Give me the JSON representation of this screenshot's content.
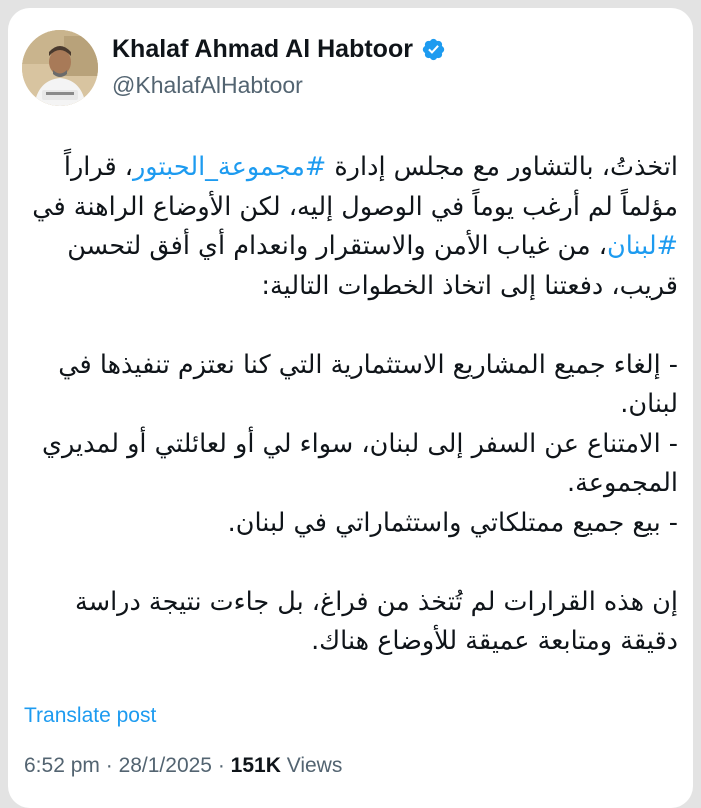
{
  "author": {
    "display_name": "Khalaf Ahmad Al Habtoor",
    "handle": "@KhalafAlHabtoor",
    "verified_icon": "verified-badge-icon",
    "avatar": "profile-photo"
  },
  "tweet": {
    "p1": {
      "t1": "اتخذتُ، بالتشاور مع مجلس إدارة ",
      "h1": "#مجموعة_الحبتور",
      "t2": "، قراراً مؤلماً لم أرغب يوماً في الوصول إليه، لكن الأوضاع الراهنة في ",
      "h2": "#لبنان",
      "t3": "، من غياب الأمن والاستقرار وانعدام أي أفق لتحسن قريب، دفعتنا إلى اتخاذ الخطوات التالية:"
    },
    "bullet1": "- إلغاء جميع المشاريع الاستثمارية التي كنا نعتزم تنفيذها في لبنان.",
    "bullet2": "- الامتناع عن السفر إلى لبنان، سواء لي أو لعائلتي أو لمديري المجموعة.",
    "bullet3": "- بيع جميع ممتلكاتي واستثماراتي في لبنان.",
    "p3": "إن هذه القرارات لم تُتخذ من فراغ، بل جاءت نتيجة دراسة دقيقة ومتابعة عميقة للأوضاع هناك."
  },
  "translate_label": "Translate post",
  "meta": {
    "time": "6:52 pm",
    "separator": " · ",
    "date": "28/1/2025",
    "views_count": "151K",
    "views_label": " Views"
  },
  "colors": {
    "link": "#1d9bf0",
    "text": "#0f1419",
    "secondary": "#536471"
  }
}
